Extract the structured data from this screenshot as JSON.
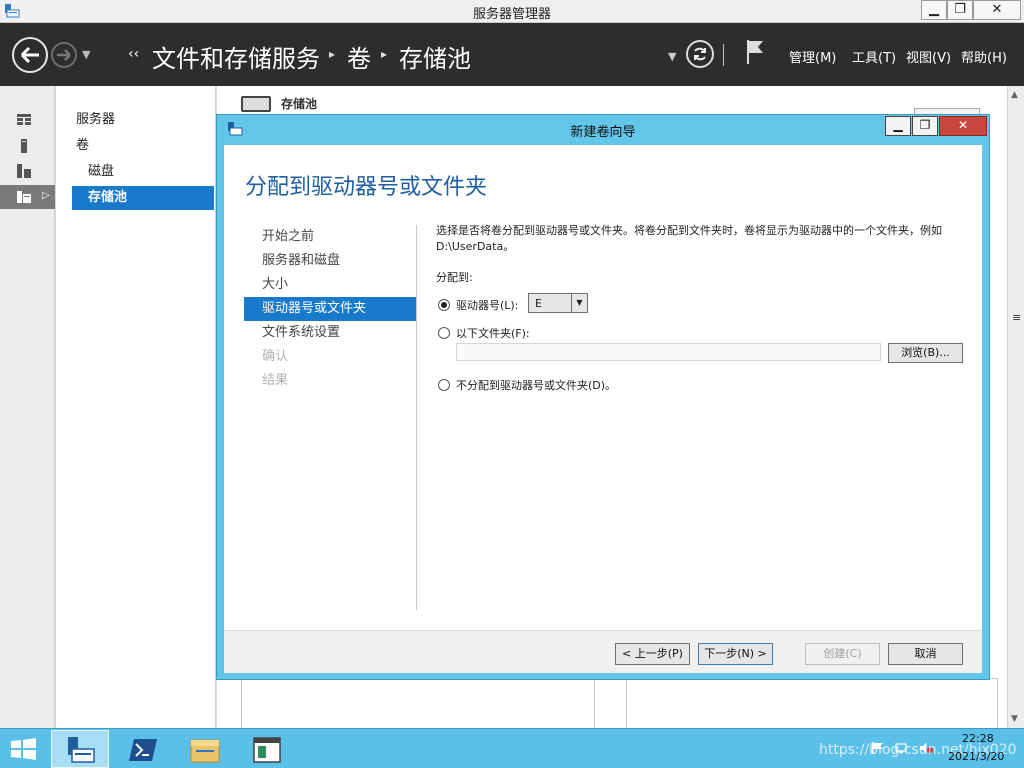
{
  "window": {
    "title": "服务器管理器",
    "min_label": "▁",
    "max_label": "❐",
    "close_label": "✕"
  },
  "breadcrumb": {
    "prefix": "‹‹",
    "items": [
      "文件和存储服务",
      "卷",
      "存储池"
    ],
    "separator": "▸"
  },
  "menu": {
    "manage": "管理(M)",
    "tools": "工具(T)",
    "view": "视图(V)",
    "help": "帮助(H)"
  },
  "nav_pane": {
    "items": [
      "服务器",
      "卷",
      "磁盘",
      "存储池"
    ]
  },
  "main": {
    "header_title": "存储池"
  },
  "dialog": {
    "title": "新建卷向导",
    "heading": "分配到驱动器号或文件夹",
    "steps": [
      "开始之前",
      "服务器和磁盘",
      "大小",
      "驱动器号或文件夹",
      "文件系统设置",
      "确认",
      "结果"
    ],
    "description": "选择是否将卷分配到驱动器号或文件夹。将卷分配到文件夹时，卷将显示为驱动器中的一个文件夹，例如 D:\\UserData。",
    "assign_label": "分配到:",
    "option_drive": "驱动器号(L):",
    "drive_value": "E",
    "option_folder": "以下文件夹(F):",
    "folder_value": "",
    "browse": "浏览(B)...",
    "option_none": "不分配到驱动器号或文件夹(D)。",
    "buttons": {
      "prev": "< 上一步(P)",
      "next": "下一步(N) >",
      "create": "创建(C)",
      "cancel": "取消"
    }
  },
  "taskbar": {
    "time": "22:28",
    "date": "2021/3/20",
    "watermark": "https://blog.csdn.net/hjx020"
  },
  "colors": {
    "accent": "#1979ca",
    "dialog_frame": "#63c6e8",
    "taskbar": "#5bc0e8",
    "navbar": "#2d2d2d"
  }
}
